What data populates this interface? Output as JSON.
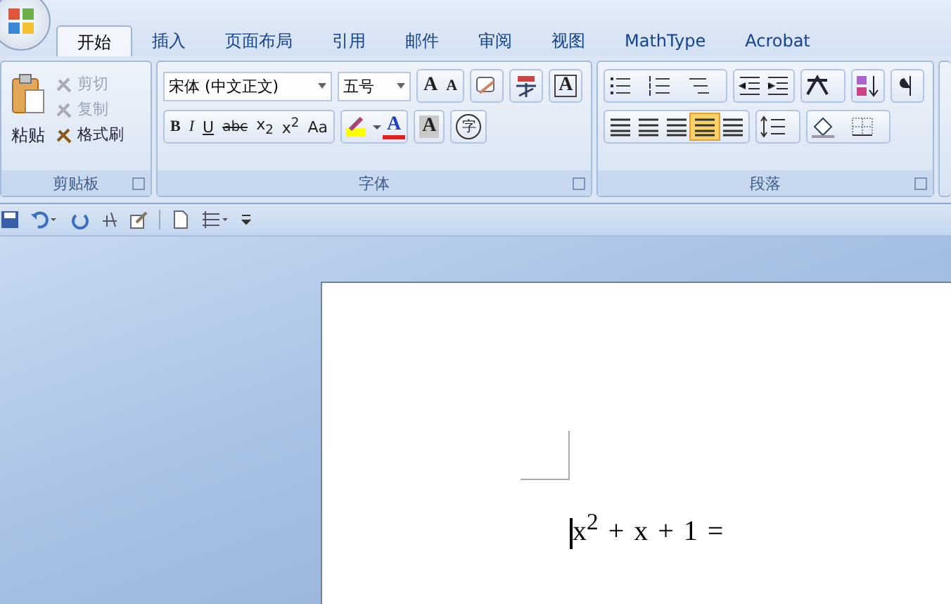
{
  "tabs": [
    {
      "label": "开始",
      "selected": true
    },
    {
      "label": "插入",
      "selected": false
    },
    {
      "label": "页面布局",
      "selected": false
    },
    {
      "label": "引用",
      "selected": false
    },
    {
      "label": "邮件",
      "selected": false
    },
    {
      "label": "审阅",
      "selected": false
    },
    {
      "label": "视图",
      "selected": false
    },
    {
      "label": "MathType",
      "selected": false
    },
    {
      "label": "Acrobat",
      "selected": false
    }
  ],
  "clipboard": {
    "paste": "粘贴",
    "items": [
      {
        "label": "剪切",
        "disabled": true
      },
      {
        "label": "复制",
        "disabled": true
      },
      {
        "label": "格式刷",
        "disabled": false
      }
    ],
    "title": "剪贴板"
  },
  "font": {
    "font_name": "宋体 (中文正文)",
    "font_size": "五号",
    "grow": "A",
    "shrink": "A",
    "char_border": "A",
    "styles": [
      "B",
      "I",
      "U",
      "abc",
      "x$_{2}$",
      "x$^{2}$",
      "Aa"
    ],
    "font_color": "A",
    "char_shading": "A",
    "enclose": "字",
    "title": "字体"
  },
  "paragraph": {
    "alignment": [
      {
        "selected": false
      },
      {
        "selected": false
      },
      {
        "selected": false
      },
      {
        "selected": true
      },
      {
        "selected": false
      }
    ],
    "title": "段落"
  },
  "document": {
    "equation": "x$^{2}$ + x + 1 ="
  }
}
